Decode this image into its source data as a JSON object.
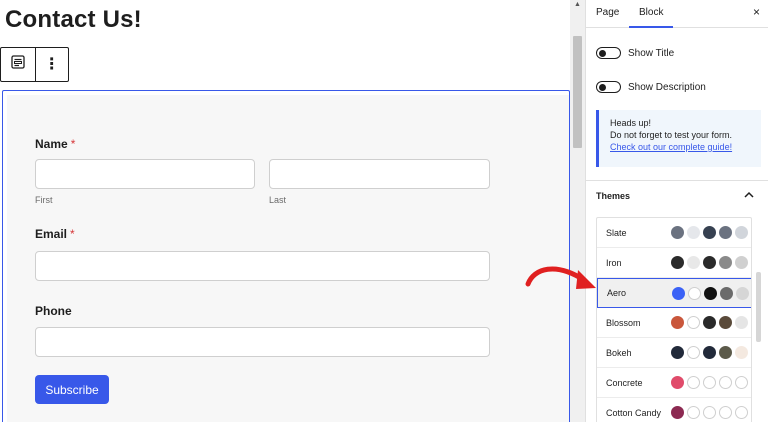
{
  "page": {
    "title": "Contact Us!"
  },
  "toolbar": {
    "form_icon": "form-block-icon",
    "more_icon": "more-options-icon",
    "more_glyph": "⋮"
  },
  "form": {
    "name_label": "Name",
    "required_mark": "*",
    "first_sublabel": "First",
    "last_sublabel": "Last",
    "email_label": "Email",
    "phone_label": "Phone",
    "submit_label": "Subscribe"
  },
  "sidebar": {
    "tabs": [
      {
        "label": "Page",
        "active": false
      },
      {
        "label": "Block",
        "active": true
      }
    ],
    "close_glyph": "×",
    "toggles": [
      {
        "label": "Show Title",
        "on": false
      },
      {
        "label": "Show Description",
        "on": false
      }
    ],
    "notice": {
      "title": "Heads up!",
      "body": "Do not forget to test your form.",
      "link": "Check out our complete guide!"
    },
    "themes_label": "Themes",
    "themes_chevron": "^"
  },
  "themes": [
    {
      "name": "Slate",
      "colors": [
        "#6b7280",
        "#e5e7eb",
        "#374151",
        "#6b7280",
        "#d1d5db"
      ],
      "selected": false
    },
    {
      "name": "Iron",
      "colors": [
        "#2b2b2b",
        "#e8e8e8",
        "#2b2b2b",
        "#8a8a8a",
        "#d0d0d0"
      ],
      "selected": false
    },
    {
      "name": "Aero",
      "colors": [
        "#3b62f6",
        "#ffffff",
        "#111111",
        "#6b6b6b",
        "#d6d6d6"
      ],
      "selected": true
    },
    {
      "name": "Blossom",
      "colors": [
        "#c9573c",
        "#ffffff",
        "#2a2a2a",
        "#5a4a3a",
        "#e5e5e5"
      ],
      "selected": false
    },
    {
      "name": "Bokeh",
      "colors": [
        "#222a3a",
        "#ffffff",
        "#222a3a",
        "#5c5a4a",
        "#f4e9e0"
      ],
      "selected": false
    },
    {
      "name": "Concrete",
      "colors": [
        "#e04c6b",
        "#ffffff",
        "#ffffff",
        "#ffffff",
        "#ffffff"
      ],
      "selected": false
    },
    {
      "name": "Cotton Candy",
      "colors": [
        "#8c2a52",
        "#ffffff",
        "#ffffff",
        "#ffffff",
        "#ffffff"
      ],
      "selected": false
    }
  ],
  "colors": {
    "accent": "#3858e9",
    "required": "#d63638",
    "annotation": "#e02020"
  }
}
